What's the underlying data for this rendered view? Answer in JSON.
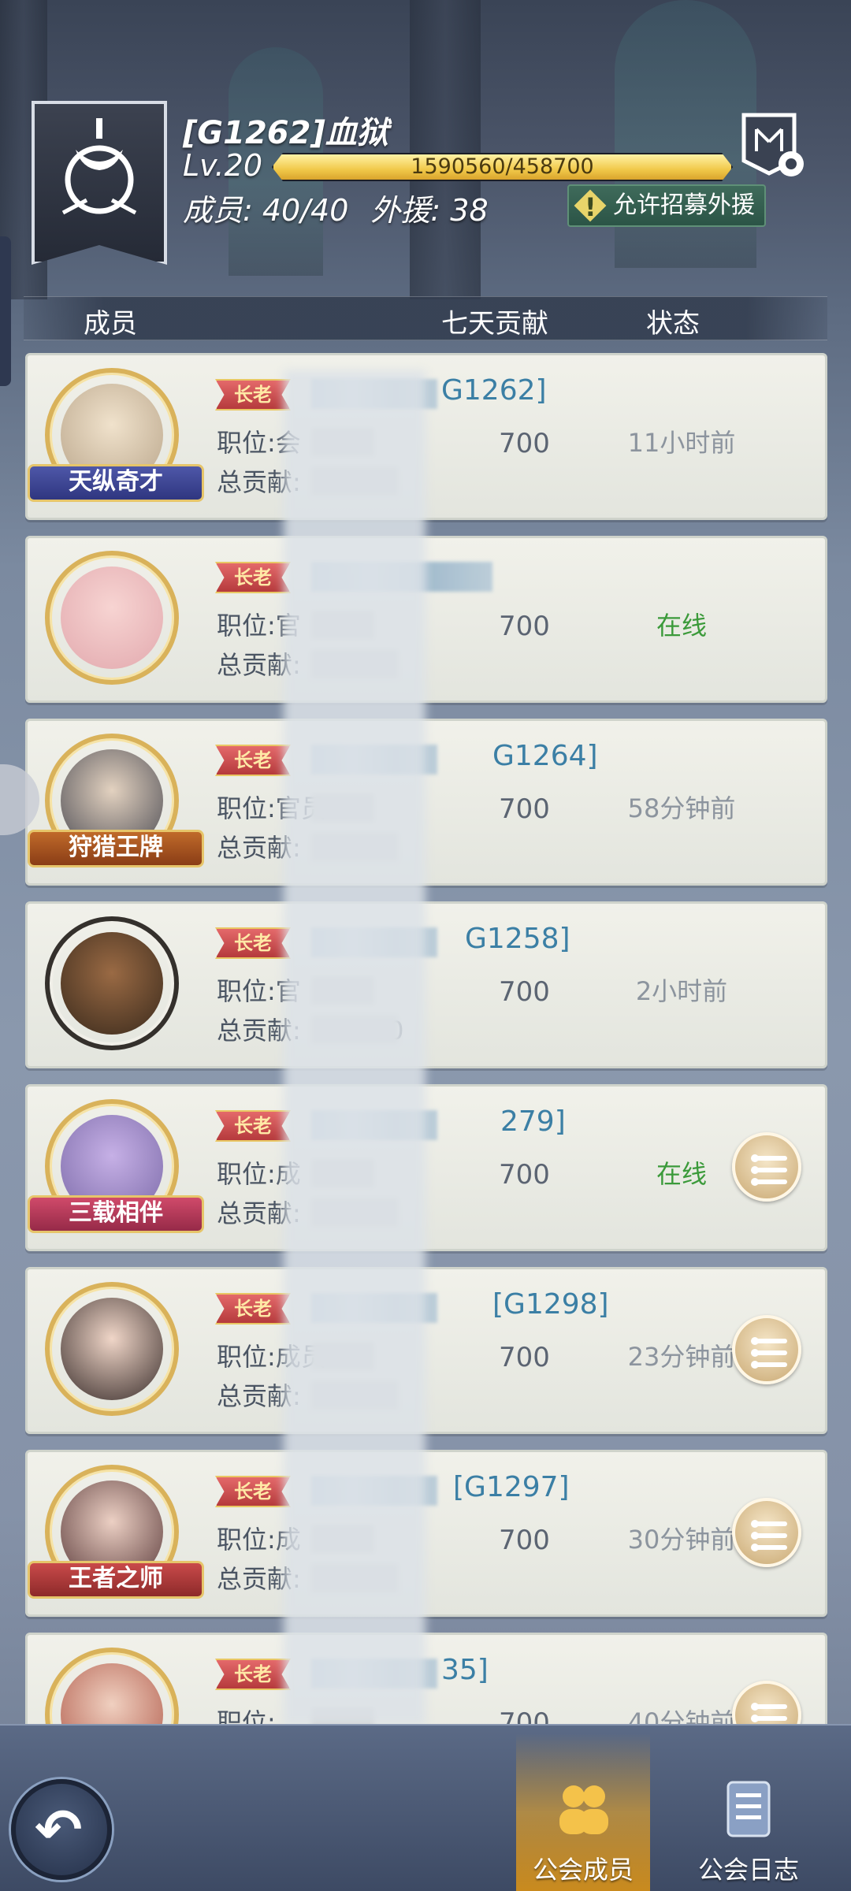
{
  "guild": {
    "name": "[G1262]血狱",
    "level": "Lv.20",
    "exp_text": "1590560/458700",
    "members": "成员: 40/40",
    "foreign_aid": "外援: 38",
    "recruit_label": "允许招募外援"
  },
  "columns": {
    "member": "成员",
    "seven_day": "七天贡献",
    "status": "状态"
  },
  "labels": {
    "position": "职位:",
    "total": "总贡献:"
  },
  "rows": [
    {
      "badge": "长老",
      "name_suffix": "G1262]",
      "position_partial": "会",
      "total_partial": "",
      "contrib": "700",
      "status": "11小时前",
      "online": false,
      "title": "天纵奇才",
      "menu": false
    },
    {
      "badge": "长老",
      "name_suffix": "",
      "position_partial": "官",
      "total_partial": "",
      "contrib": "700",
      "status": "在线",
      "online": true,
      "title": "",
      "menu": false
    },
    {
      "badge": "长老",
      "name_suffix": "G1264]",
      "position_partial": "官员",
      "total_partial": "4",
      "contrib": "700",
      "status": "58分钟前",
      "online": false,
      "title": "狩猎王牌",
      "menu": false
    },
    {
      "badge": "长老",
      "name_suffix": "G1258]",
      "position_partial": "官",
      "total_partial": "00",
      "contrib": "700",
      "status": "2小时前",
      "online": false,
      "title": "",
      "menu": false
    },
    {
      "badge": "长老",
      "name_suffix": "279]",
      "position_partial": "成",
      "total_partial": "1",
      "contrib": "700",
      "status": "在线",
      "online": true,
      "title": "三载相伴",
      "menu": true
    },
    {
      "badge": "长老",
      "name_suffix": "[G1298]",
      "position_partial": "成员",
      "total_partial": "1",
      "contrib": "700",
      "status": "23分钟前",
      "online": false,
      "title": "",
      "menu": true
    },
    {
      "badge": "长老",
      "name_suffix": "[G1297]",
      "position_partial": "成",
      "total_partial": "",
      "contrib": "700",
      "status": "30分钟前",
      "online": false,
      "title": "王者之师",
      "menu": true
    },
    {
      "badge": "长老",
      "name_suffix": "35]",
      "position_partial": "",
      "total_partial": "",
      "contrib": "700",
      "status": "40分钟前",
      "online": false,
      "title": "",
      "menu": true
    }
  ],
  "tabs": {
    "members": "公会成员",
    "log": "公会日志"
  },
  "colors": {
    "online": "#3b9a3a",
    "name": "#3b7fa5",
    "exp_fill": "#f1c94a"
  },
  "exp_fraction": 1.0
}
